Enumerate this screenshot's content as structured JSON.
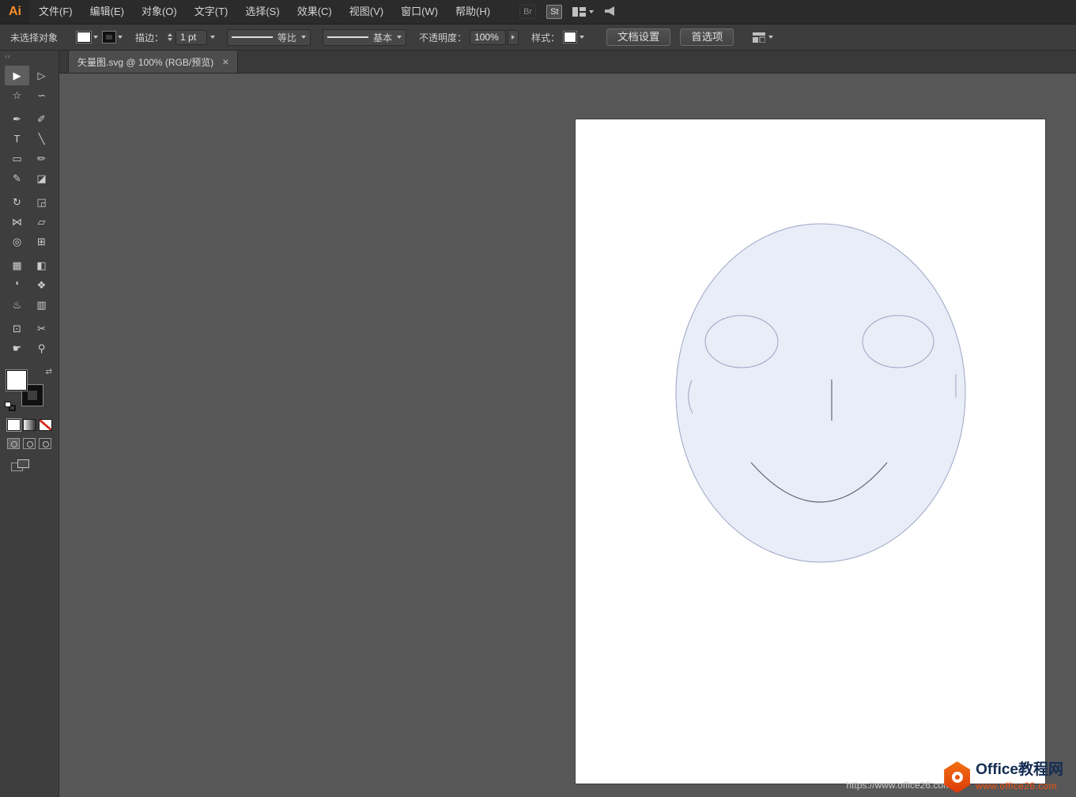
{
  "app": {
    "logo_text": "Ai",
    "menu_items": [
      {
        "label": "文件(F)"
      },
      {
        "label": "编辑(E)"
      },
      {
        "label": "对象(O)"
      },
      {
        "label": "文字(T)"
      },
      {
        "label": "选择(S)"
      },
      {
        "label": "效果(C)"
      },
      {
        "label": "视图(V)"
      },
      {
        "label": "窗口(W)"
      },
      {
        "label": "帮助(H)"
      }
    ],
    "topbar_icons": {
      "bridge": "Br",
      "stock": "St"
    }
  },
  "control_bar": {
    "status_text": "未选择对象",
    "stroke_label": "描边：",
    "stroke_width_value": "1 pt",
    "profile_value": "等比",
    "brush_value": "基本",
    "opacity_label": "不透明度：",
    "opacity_value": "100%",
    "style_label": "样式：",
    "document_setup_label": "文档设置",
    "preferences_label": "首选项"
  },
  "document_tab": {
    "title": "矢量图.svg @ 100%  (RGB/预览)",
    "close_glyph": "×"
  },
  "toolbar": {
    "collapse_glyph": "‹‹",
    "swap_glyph": "⇄",
    "tools": {
      "selection": "▶",
      "direct_selection": "▷",
      "magic_wand": "☆",
      "lasso": "∽",
      "pen": "✒",
      "curvature": "✐",
      "type": "T",
      "line_segment": "╲",
      "rectangle": "▭",
      "paintbrush": "✏",
      "pencil": "✎",
      "eraser": "◪",
      "rotate": "↻",
      "scale": "◲",
      "width_tool": "⋈",
      "free_transform": "▱",
      "shape_builder": "◎",
      "perspective_grid": "⊞",
      "mesh": "▦",
      "gradient": "◧",
      "eyedropper": "❛",
      "blend": "❖",
      "symbol_sprayer": "♨",
      "column_graph": "▥",
      "artboard_tool": "⊡",
      "slice": "✂",
      "hand": "☛",
      "zoom": "⚲"
    }
  },
  "artboard": {
    "face_fill": "#e9edf8",
    "outline_color": "#9aa5c2",
    "feature_color": "#5f6672"
  },
  "watermark": {
    "title": "Office教程网",
    "url": "www.office26.com",
    "faint_url": "https://www.office26.com",
    "brand_color": "#e8480e"
  }
}
